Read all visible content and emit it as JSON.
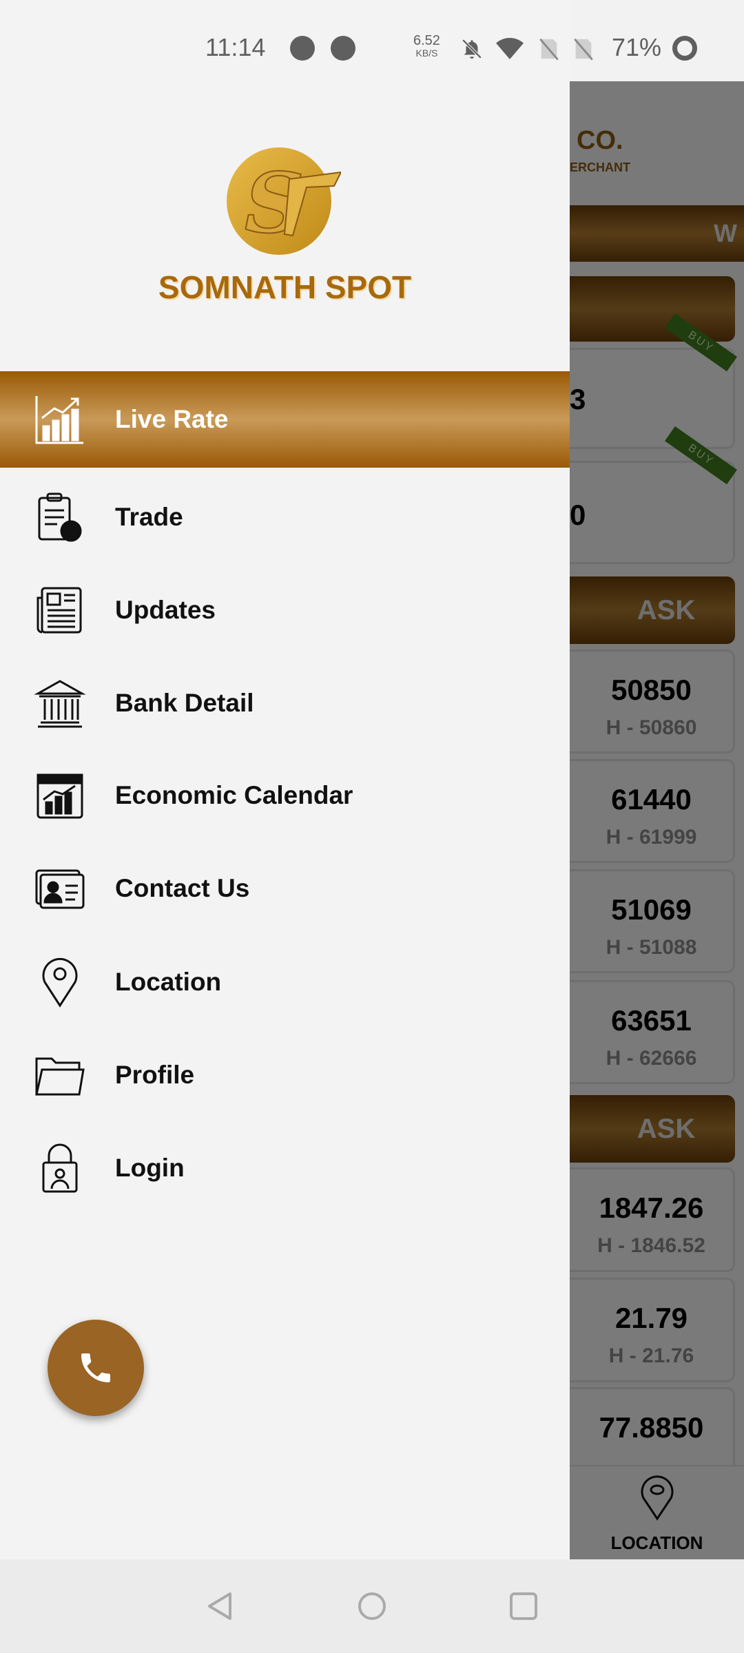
{
  "status_bar": {
    "time": "11:14",
    "net_speed": "6.52",
    "net_unit": "KB/S",
    "battery": "71%"
  },
  "drawer": {
    "brand": "SOMNATH SPOT",
    "items": [
      {
        "label": "Live Rate",
        "icon": "chart-icon",
        "active": true
      },
      {
        "label": "Trade",
        "icon": "clipboard-chart-icon"
      },
      {
        "label": "Updates",
        "icon": "newspaper-icon"
      },
      {
        "label": "Bank Detail",
        "icon": "bank-icon"
      },
      {
        "label": "Economic Calendar",
        "icon": "calendar-chart-icon"
      },
      {
        "label": "Contact Us",
        "icon": "contact-card-icon"
      },
      {
        "label": "Location",
        "icon": "map-pin-icon"
      },
      {
        "label": "Profile",
        "icon": "folder-icon"
      },
      {
        "label": "Login",
        "icon": "lock-user-icon"
      }
    ],
    "fab_icon": "phone-icon"
  },
  "background": {
    "header_title": "CO.",
    "header_sub": "ERCHANT",
    "bar_text": "W",
    "buy_cards": [
      {
        "value": "3",
        "badge": "BUY"
      },
      {
        "value": "0",
        "badge": "BUY"
      }
    ],
    "ask_label": "ASK",
    "group1": [
      {
        "value": "50850",
        "sub": "H - 50860"
      },
      {
        "value": "61440",
        "sub": "H - 61999"
      },
      {
        "value": "51069",
        "sub": "H - 51088"
      },
      {
        "value": "63651",
        "sub": "H - 62666"
      }
    ],
    "group2": [
      {
        "value": "1847.26",
        "sub": "H - 1846.52"
      },
      {
        "value": "21.79",
        "sub": "H - 21.76"
      },
      {
        "value": "77.8850",
        "sub": ""
      }
    ],
    "nav_label": "LOCATION"
  }
}
